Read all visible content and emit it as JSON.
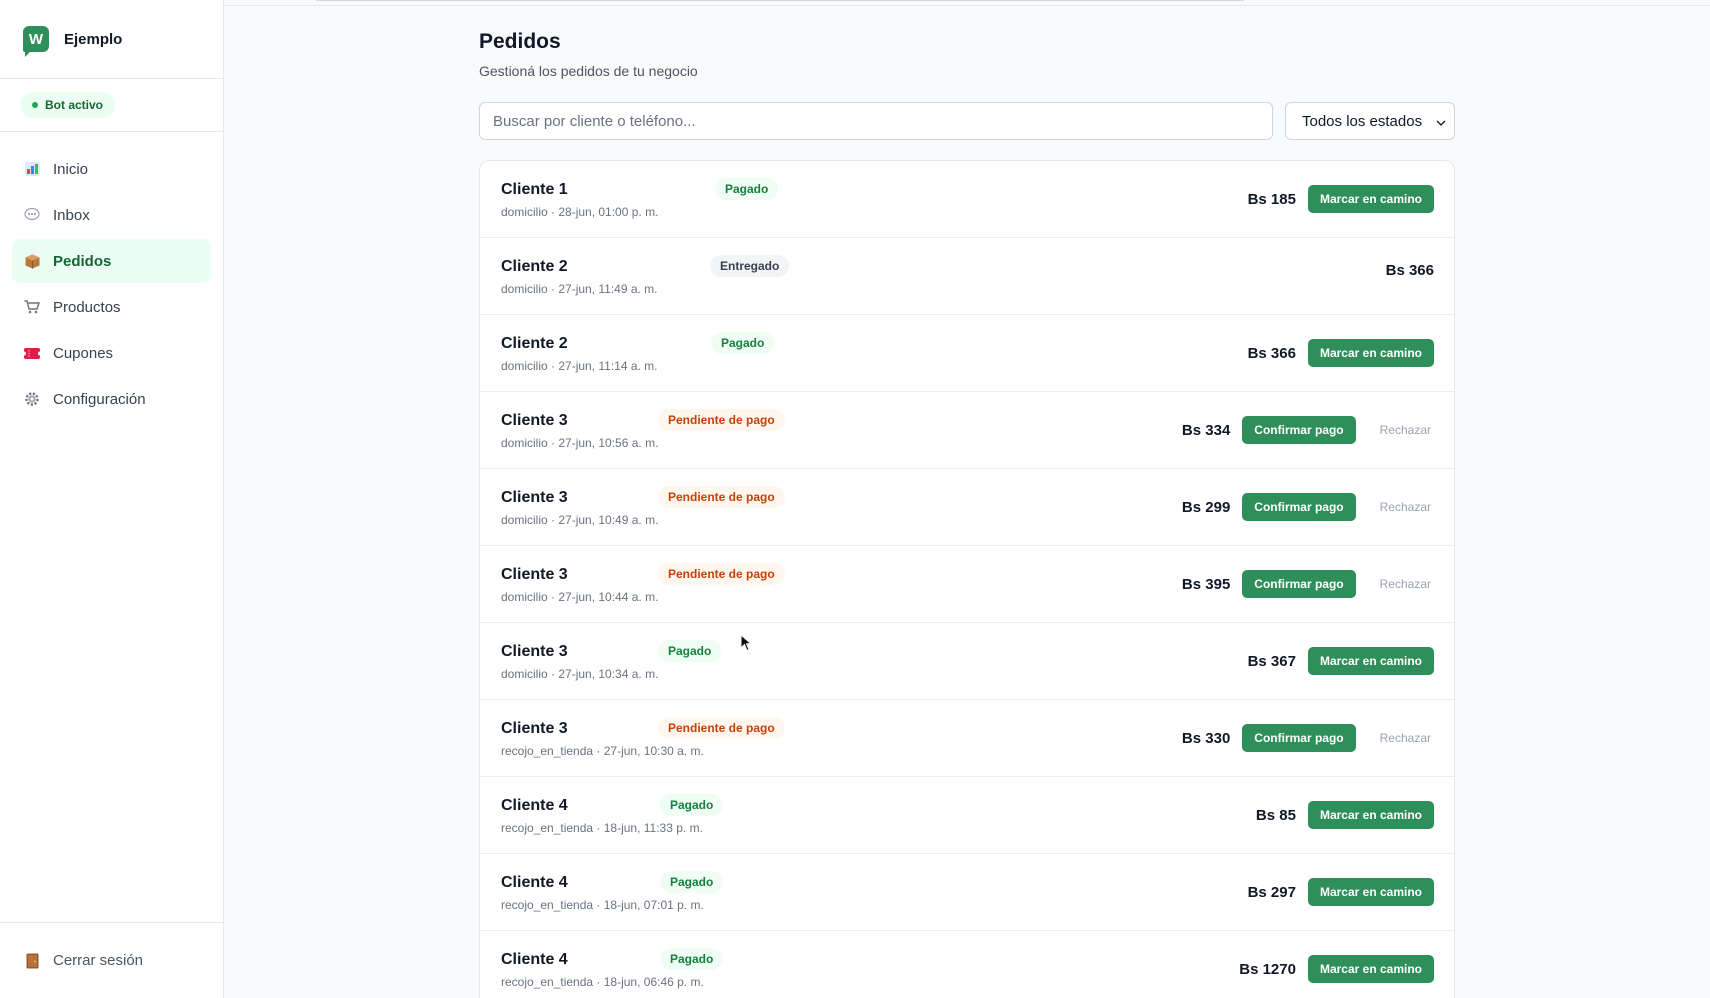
{
  "brand": {
    "name": "Ejemplo",
    "logo_letter": "W",
    "color": "#2f8f5b"
  },
  "bot_status": "Bot activo",
  "nav": [
    {
      "label": "Inicio",
      "icon": "chart-icon"
    },
    {
      "label": "Inbox",
      "icon": "chat-bubble-icon"
    },
    {
      "label": "Pedidos",
      "icon": "package-icon",
      "active": true
    },
    {
      "label": "Productos",
      "icon": "cart-icon"
    },
    {
      "label": "Cupones",
      "icon": "ticket-icon"
    },
    {
      "label": "Configuración",
      "icon": "gear-icon"
    }
  ],
  "logout_label": "Cerrar sesión",
  "page": {
    "title": "Pedidos",
    "subtitle": "Gestioná los pedidos de tu negocio"
  },
  "search": {
    "placeholder": "Buscar por cliente o teléfono...",
    "value": ""
  },
  "status_filter": {
    "selected": "Todos los estados"
  },
  "orders": [
    {
      "client": "Cliente 1",
      "status": "Pagado",
      "meta": "domicilio · 28-jun, 01:00 p. m.",
      "amount": "Bs 185",
      "action": "Marcar en camino",
      "reject": ""
    },
    {
      "client": "Cliente 2",
      "status": "Entregado",
      "meta": "domicilio · 27-jun, 11:49 a. m.",
      "amount": "Bs 366",
      "action": "",
      "reject": ""
    },
    {
      "client": "Cliente 2",
      "status": "Pagado",
      "meta": "domicilio · 27-jun, 11:14 a. m.",
      "amount": "Bs 366",
      "action": "Marcar en camino",
      "reject": ""
    },
    {
      "client": "Cliente 3",
      "status": "Pendiente de pago",
      "meta": "domicilio · 27-jun, 10:56 a. m.",
      "amount": "Bs 334",
      "action": "Confirmar pago",
      "reject": "Rechazar"
    },
    {
      "client": "Cliente 3",
      "status": "Pendiente de pago",
      "meta": "domicilio · 27-jun, 10:49 a. m.",
      "amount": "Bs 299",
      "action": "Confirmar pago",
      "reject": "Rechazar"
    },
    {
      "client": "Cliente 3",
      "status": "Pendiente de pago",
      "meta": "domicilio · 27-jun, 10:44 a. m.",
      "amount": "Bs 395",
      "action": "Confirmar pago",
      "reject": "Rechazar"
    },
    {
      "client": "Cliente 3",
      "status": "Pagado",
      "meta": "domicilio · 27-jun, 10:34 a. m.",
      "amount": "Bs 367",
      "action": "Marcar en camino",
      "reject": ""
    },
    {
      "client": "Cliente 3",
      "status": "Pendiente de pago",
      "meta": "recojo_en_tienda · 27-jun, 10:30 a. m.",
      "amount": "Bs 330",
      "action": "Confirmar pago",
      "reject": "Rechazar"
    },
    {
      "client": "Cliente 4",
      "status": "Pagado",
      "meta": "recojo_en_tienda · 18-jun, 11:33 p. m.",
      "amount": "Bs 85",
      "action": "Marcar en camino",
      "reject": ""
    },
    {
      "client": "Cliente 4",
      "status": "Pagado",
      "meta": "recojo_en_tienda · 18-jun, 07:01 p. m.",
      "amount": "Bs 297",
      "action": "Marcar en camino",
      "reject": ""
    },
    {
      "client": "Cliente 4",
      "status": "Pagado",
      "meta": "recojo_en_tienda · 18-jun, 06:46 p. m.",
      "amount": "Bs 1270",
      "action": "Marcar en camino",
      "reject": ""
    }
  ]
}
